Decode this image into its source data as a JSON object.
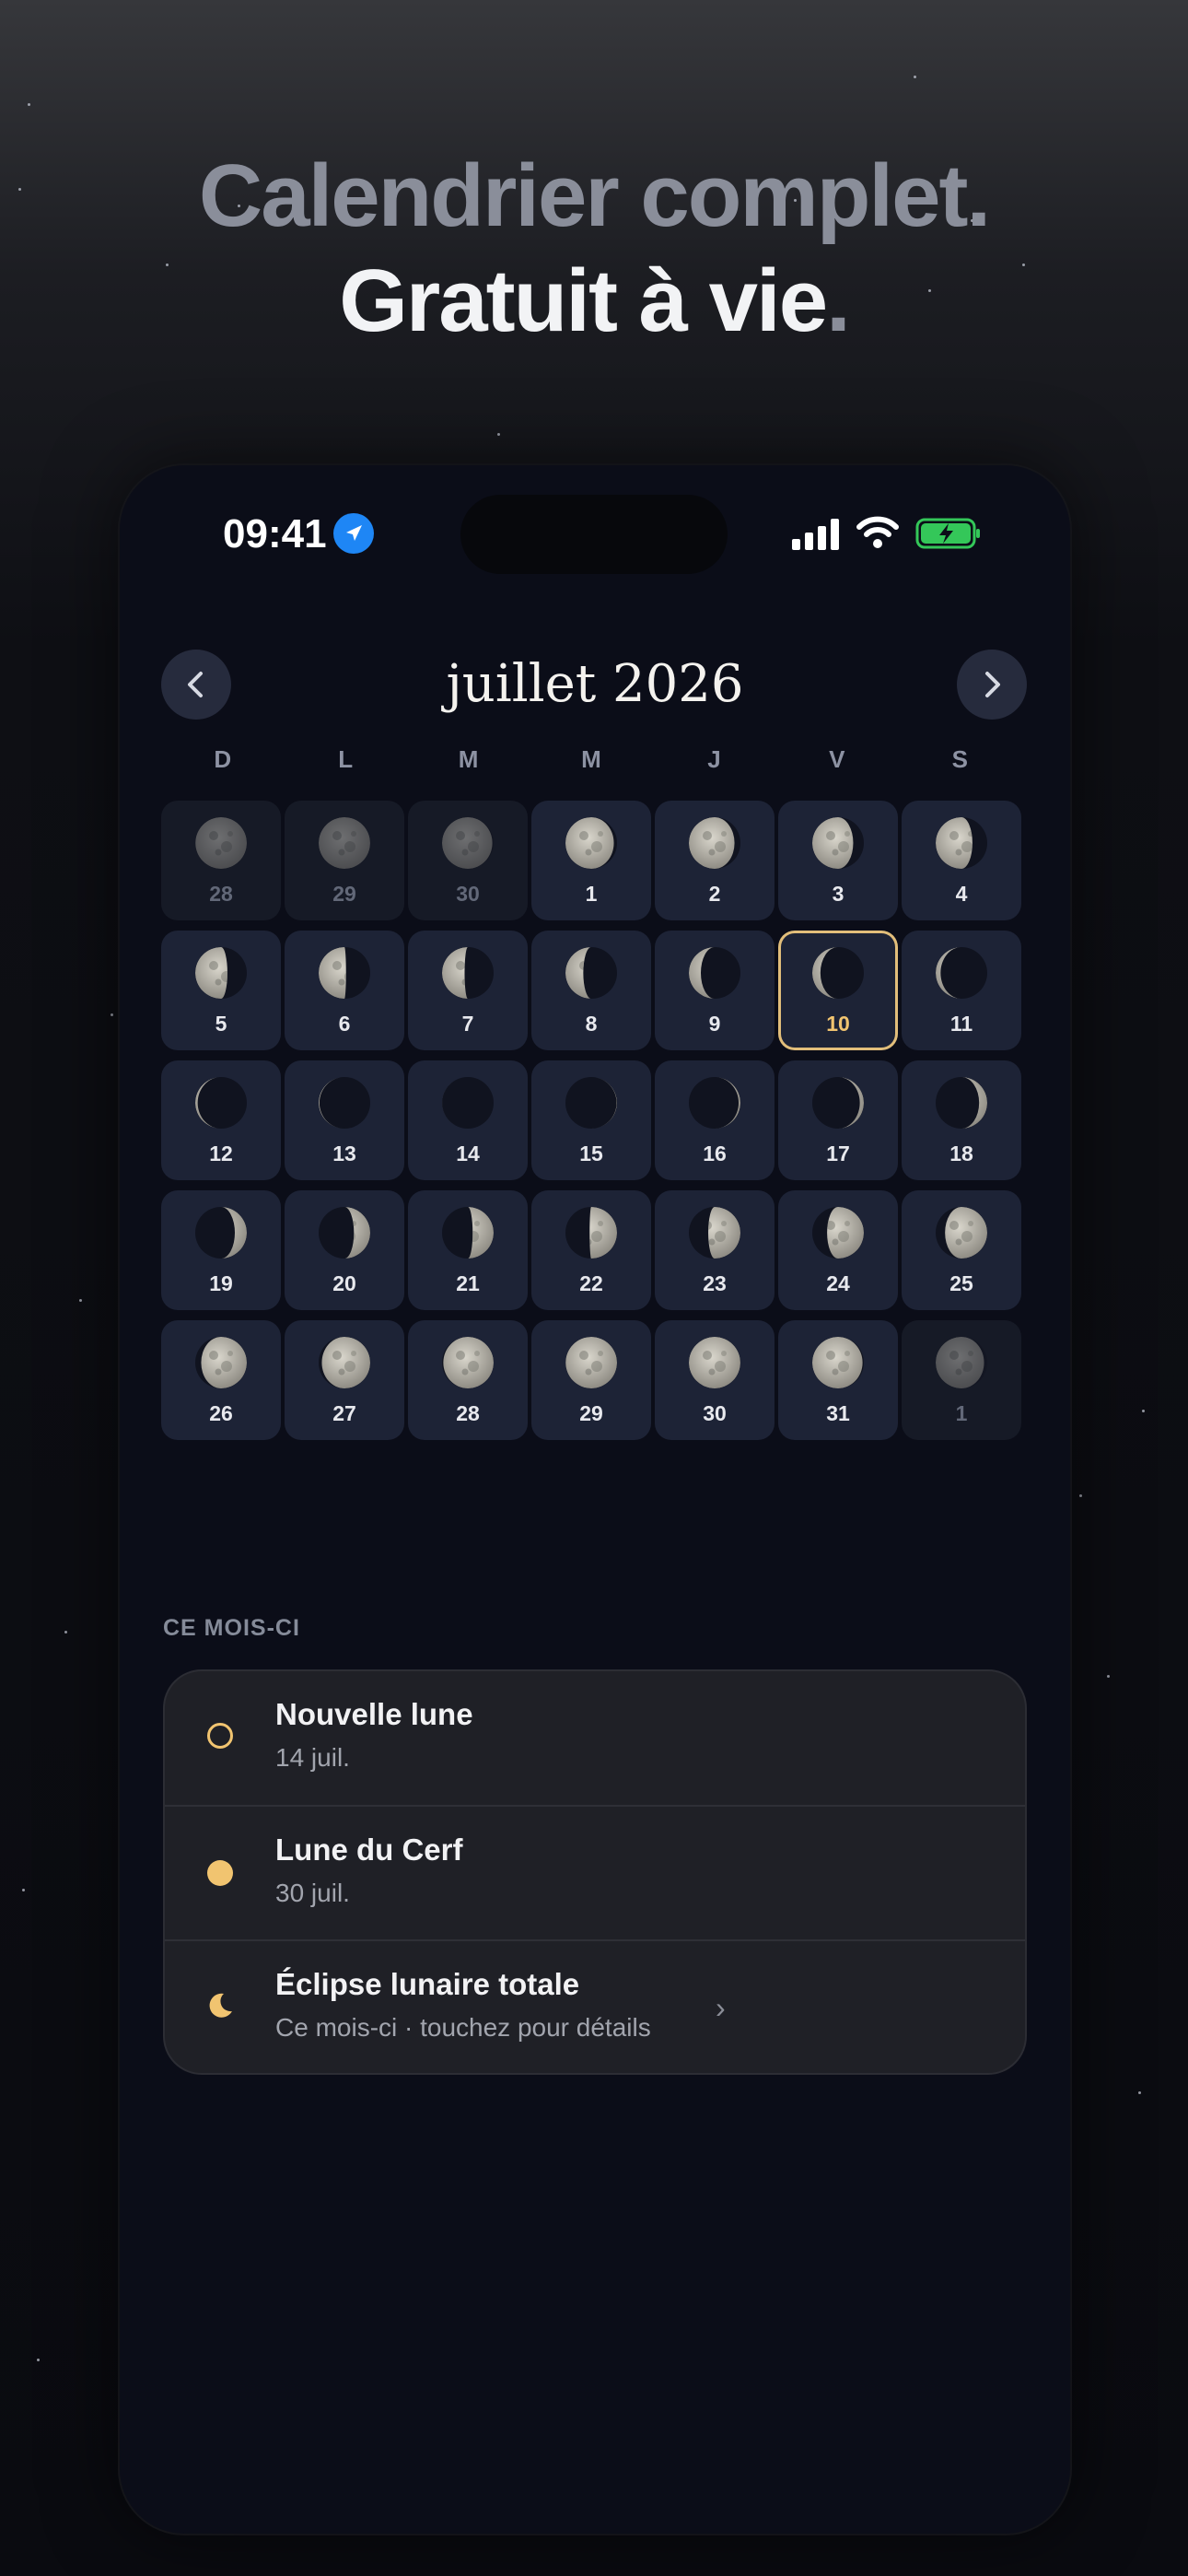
{
  "headline": {
    "line1": "Calendrier complet.",
    "line2": "Gratuit à vie",
    "line2_dot": "."
  },
  "status_bar": {
    "time": "09:41"
  },
  "calendar": {
    "month_title": "juillet 2026",
    "weekdays": [
      "D",
      "L",
      "M",
      "M",
      "J",
      "V",
      "S"
    ],
    "days": [
      {
        "day": "28",
        "outside": true,
        "phase": 0.48
      },
      {
        "day": "29",
        "outside": true,
        "phase": 0.51
      },
      {
        "day": "30",
        "outside": true,
        "phase": 0.55
      },
      {
        "day": "1",
        "phase": 0.58
      },
      {
        "day": "2",
        "phase": 0.61
      },
      {
        "day": "3",
        "phase": 0.65
      },
      {
        "day": "4",
        "phase": 0.68
      },
      {
        "day": "5",
        "phase": 0.71
      },
      {
        "day": "6",
        "phase": 0.74
      },
      {
        "day": "7",
        "phase": 0.77
      },
      {
        "day": "8",
        "phase": 0.8
      },
      {
        "day": "9",
        "phase": 0.84
      },
      {
        "day": "10",
        "phase": 0.87,
        "today": true
      },
      {
        "day": "11",
        "phase": 0.9
      },
      {
        "day": "12",
        "phase": 0.93
      },
      {
        "day": "13",
        "phase": 0.96
      },
      {
        "day": "14",
        "phase": 0.99
      },
      {
        "day": "15",
        "phase": 0.03
      },
      {
        "day": "16",
        "phase": 0.06
      },
      {
        "day": "17",
        "phase": 0.09
      },
      {
        "day": "18",
        "phase": 0.13
      },
      {
        "day": "19",
        "phase": 0.16
      },
      {
        "day": "20",
        "phase": 0.19
      },
      {
        "day": "21",
        "phase": 0.22
      },
      {
        "day": "22",
        "phase": 0.26
      },
      {
        "day": "23",
        "phase": 0.29
      },
      {
        "day": "24",
        "phase": 0.32
      },
      {
        "day": "25",
        "phase": 0.36
      },
      {
        "day": "26",
        "phase": 0.39
      },
      {
        "day": "27",
        "phase": 0.42
      },
      {
        "day": "28",
        "phase": 0.45
      },
      {
        "day": "29",
        "phase": 0.48
      },
      {
        "day": "30",
        "phase": 0.51
      },
      {
        "day": "31",
        "phase": 0.55
      },
      {
        "day": "1",
        "outside": true,
        "phase": 0.58
      }
    ]
  },
  "this_month": {
    "label": "CE MOIS-CI",
    "events": [
      {
        "title": "Nouvelle lune",
        "subtitle": "14 juil.",
        "icon": "new-moon-icon",
        "color": "#f1c470"
      },
      {
        "title": "Lune du Cerf",
        "subtitle": "30 juil.",
        "icon": "full-moon-icon",
        "color": "#f1c470"
      },
      {
        "title": "Éclipse lunaire totale",
        "subtitle": "Ce mois-ci · touchez pour détails",
        "icon": "crescent-moon-icon",
        "color": "#f1c470",
        "chevron": "›"
      }
    ]
  },
  "colors": {
    "accent": "#f1c470",
    "background": "#0b0d18"
  }
}
